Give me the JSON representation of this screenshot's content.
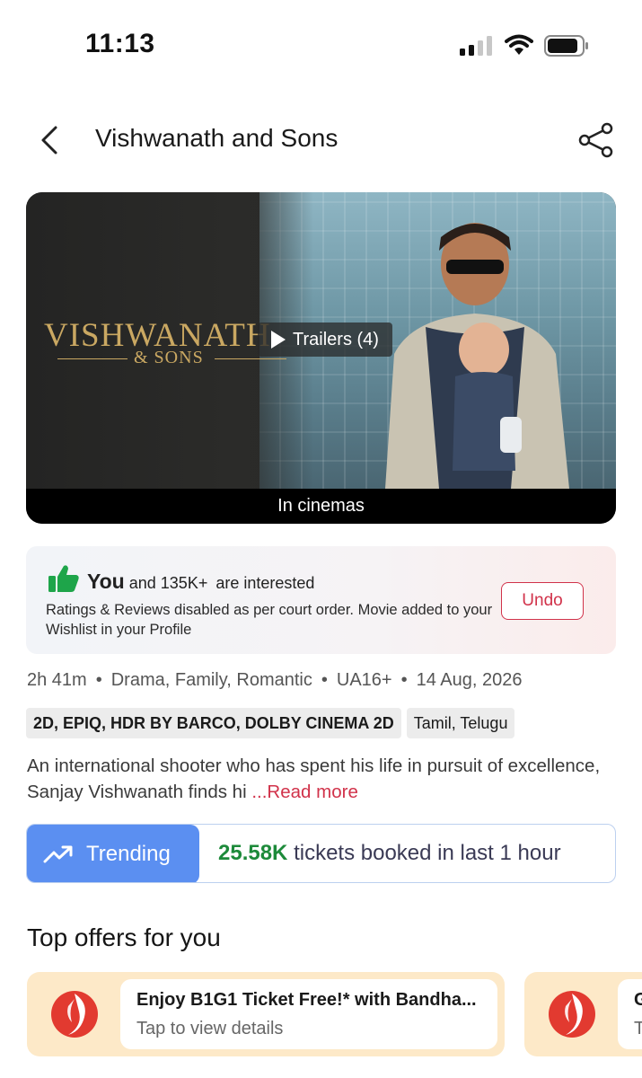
{
  "status_bar": {
    "time": "11:13"
  },
  "header": {
    "title": "Vishwanath and Sons"
  },
  "banner": {
    "poster_title": "VISHWANATH",
    "poster_subtitle": "& SONS",
    "trailers_label": "Trailers (4)",
    "release_strip": "In cinemas"
  },
  "interest": {
    "you": "You",
    "text_mid": "and 135K+",
    "text_end": "are interested",
    "note": "Ratings & Reviews disabled as per court order. Movie added to your Wishlist in your Profile",
    "undo_label": "Undo"
  },
  "meta": {
    "duration": "2h 41m",
    "genres": "Drama, Family, Romantic",
    "certificate": "UA16+",
    "release_date": "14 Aug, 2026"
  },
  "tags": {
    "formats": "2D, EPIQ, HDR BY BARCO, DOLBY CINEMA 2D",
    "languages": "Tamil, Telugu"
  },
  "synopsis": {
    "text": "An international shooter who has spent his life in pursuit of excellence, Sanjay Vishwanath finds hi",
    "read_more": "...Read more"
  },
  "trending": {
    "label": "Trending",
    "count": "25.58K",
    "text": "tickets booked in last 1 hour"
  },
  "offers": {
    "title": "Top offers for you",
    "items": [
      {
        "title": "Enjoy B1G1 Ticket Free!* with Bandha...",
        "subtitle": "Tap to view details"
      },
      {
        "title": "G",
        "subtitle": "T"
      }
    ]
  },
  "colors": {
    "accent_red": "#d1324a",
    "trend_blue": "#5b8ff1",
    "trend_green": "#1d8a3a",
    "offer_bg": "#fde9c8"
  }
}
